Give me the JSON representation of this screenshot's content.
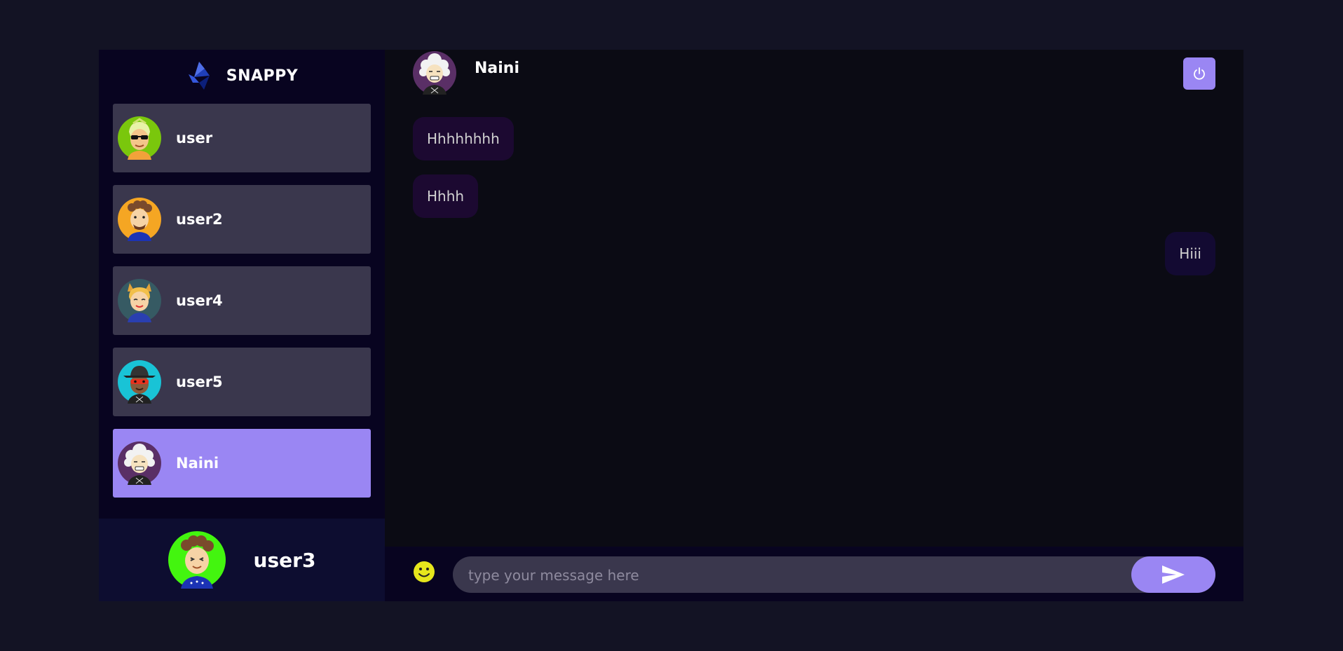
{
  "brand": {
    "name": "SNAPPY"
  },
  "contacts": [
    {
      "name": "user",
      "avatar": "avatar-sunglasses-icon",
      "avatar_bg": "#7ac70c",
      "selected": false
    },
    {
      "name": "user2",
      "avatar": "avatar-curly-hair-icon",
      "avatar_bg": "#f5a623",
      "selected": false
    },
    {
      "name": "user4",
      "avatar": "avatar-cat-ears-icon",
      "avatar_bg": "#365a63",
      "selected": false
    },
    {
      "name": "user5",
      "avatar": "avatar-fedora-mask-icon",
      "avatar_bg": "#19c3d6",
      "selected": false
    },
    {
      "name": "Naini",
      "avatar": "avatar-white-hair-icon",
      "avatar_bg": "#5a2f66",
      "selected": true
    }
  ],
  "current_user": {
    "name": "user3",
    "avatar": "avatar-curly-hair-icon",
    "avatar_bg": "#43f50f"
  },
  "chat": {
    "header_name": "Naini",
    "messages": [
      {
        "text": "Hhhhhhhh",
        "direction": "received"
      },
      {
        "text": "Hhhh",
        "direction": "received"
      },
      {
        "text": "Hiii",
        "direction": "sent"
      }
    ],
    "input_placeholder": "type your message here",
    "input_value": ""
  },
  "icons": {
    "logout": "power-icon",
    "emoji": "emoji-smile-icon",
    "send": "send-icon"
  },
  "colors": {
    "accent": "#9a86f3",
    "page_bg": "#131324",
    "sidebar_bg": "#080420",
    "current_user_bg": "#0d0d30",
    "emoji": "#ffff00c8"
  }
}
